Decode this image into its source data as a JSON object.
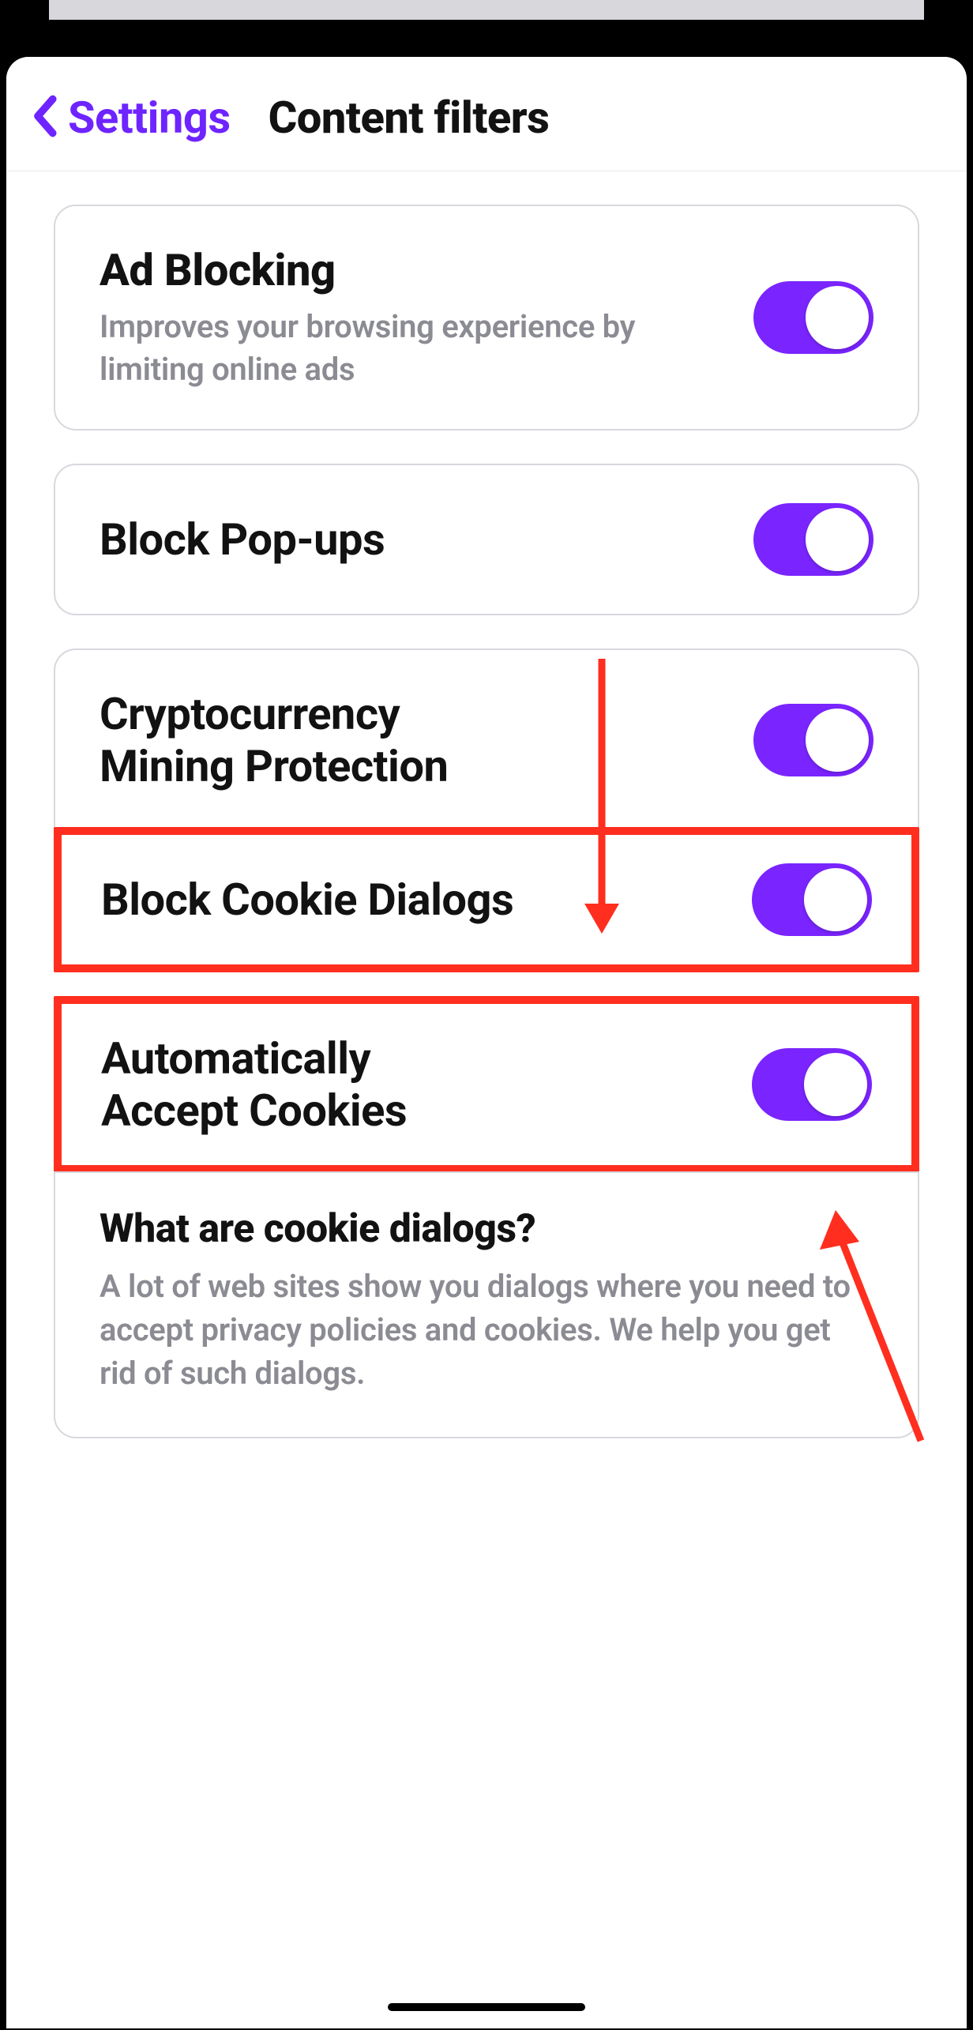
{
  "header": {
    "back_label": "Settings",
    "title": "Content filters"
  },
  "rows": {
    "ad_blocking": {
      "title": "Ad Blocking",
      "subtitle": "Improves your browsing experience by limiting online ads"
    },
    "popups": {
      "title": "Block Pop-ups"
    },
    "crypto": {
      "title": "Cryptocurrency Mining Protection"
    },
    "cookie_dialogs": {
      "title": "Block Cookie Dialogs"
    },
    "accept_cookies": {
      "title": "Automatically Accept Cookies"
    }
  },
  "info": {
    "title": "What are cookie dialogs?",
    "body": "A lot of web sites show you dialogs where you need to accept privacy policies and cookies. We help you get rid of such dialogs."
  },
  "colors": {
    "accent": "#7a24ff",
    "annotation": "#ff2e1f"
  }
}
